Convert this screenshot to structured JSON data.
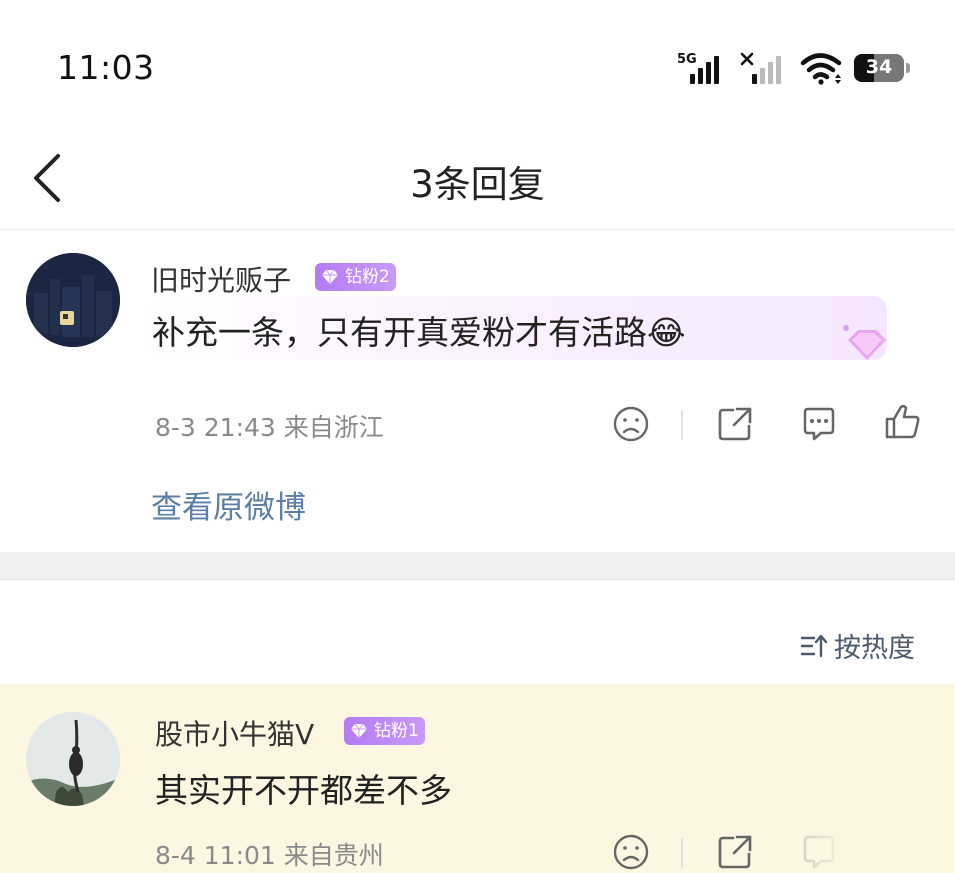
{
  "status_bar": {
    "time": "11:03",
    "network_label": "5G",
    "battery_level": "34"
  },
  "nav": {
    "title": "3条回复"
  },
  "main_comment": {
    "username": "旧时光贩子",
    "badge": "钻粉2",
    "text": "补充一条，只有开真爱粉才有活路😂",
    "meta": "8-3 21:43  来自浙江",
    "view_original": "查看原微博"
  },
  "sort": {
    "label": "按热度"
  },
  "replies": [
    {
      "username": "股市小牛猫V",
      "badge": "钻粉1",
      "text": "其实开不开都差不多",
      "meta": "8-4 11:01  来自贵州"
    }
  ],
  "colors": {
    "badge": "#b57bf4",
    "link": "#5b7fa6",
    "highlight_bg": "#fdf6e0"
  }
}
